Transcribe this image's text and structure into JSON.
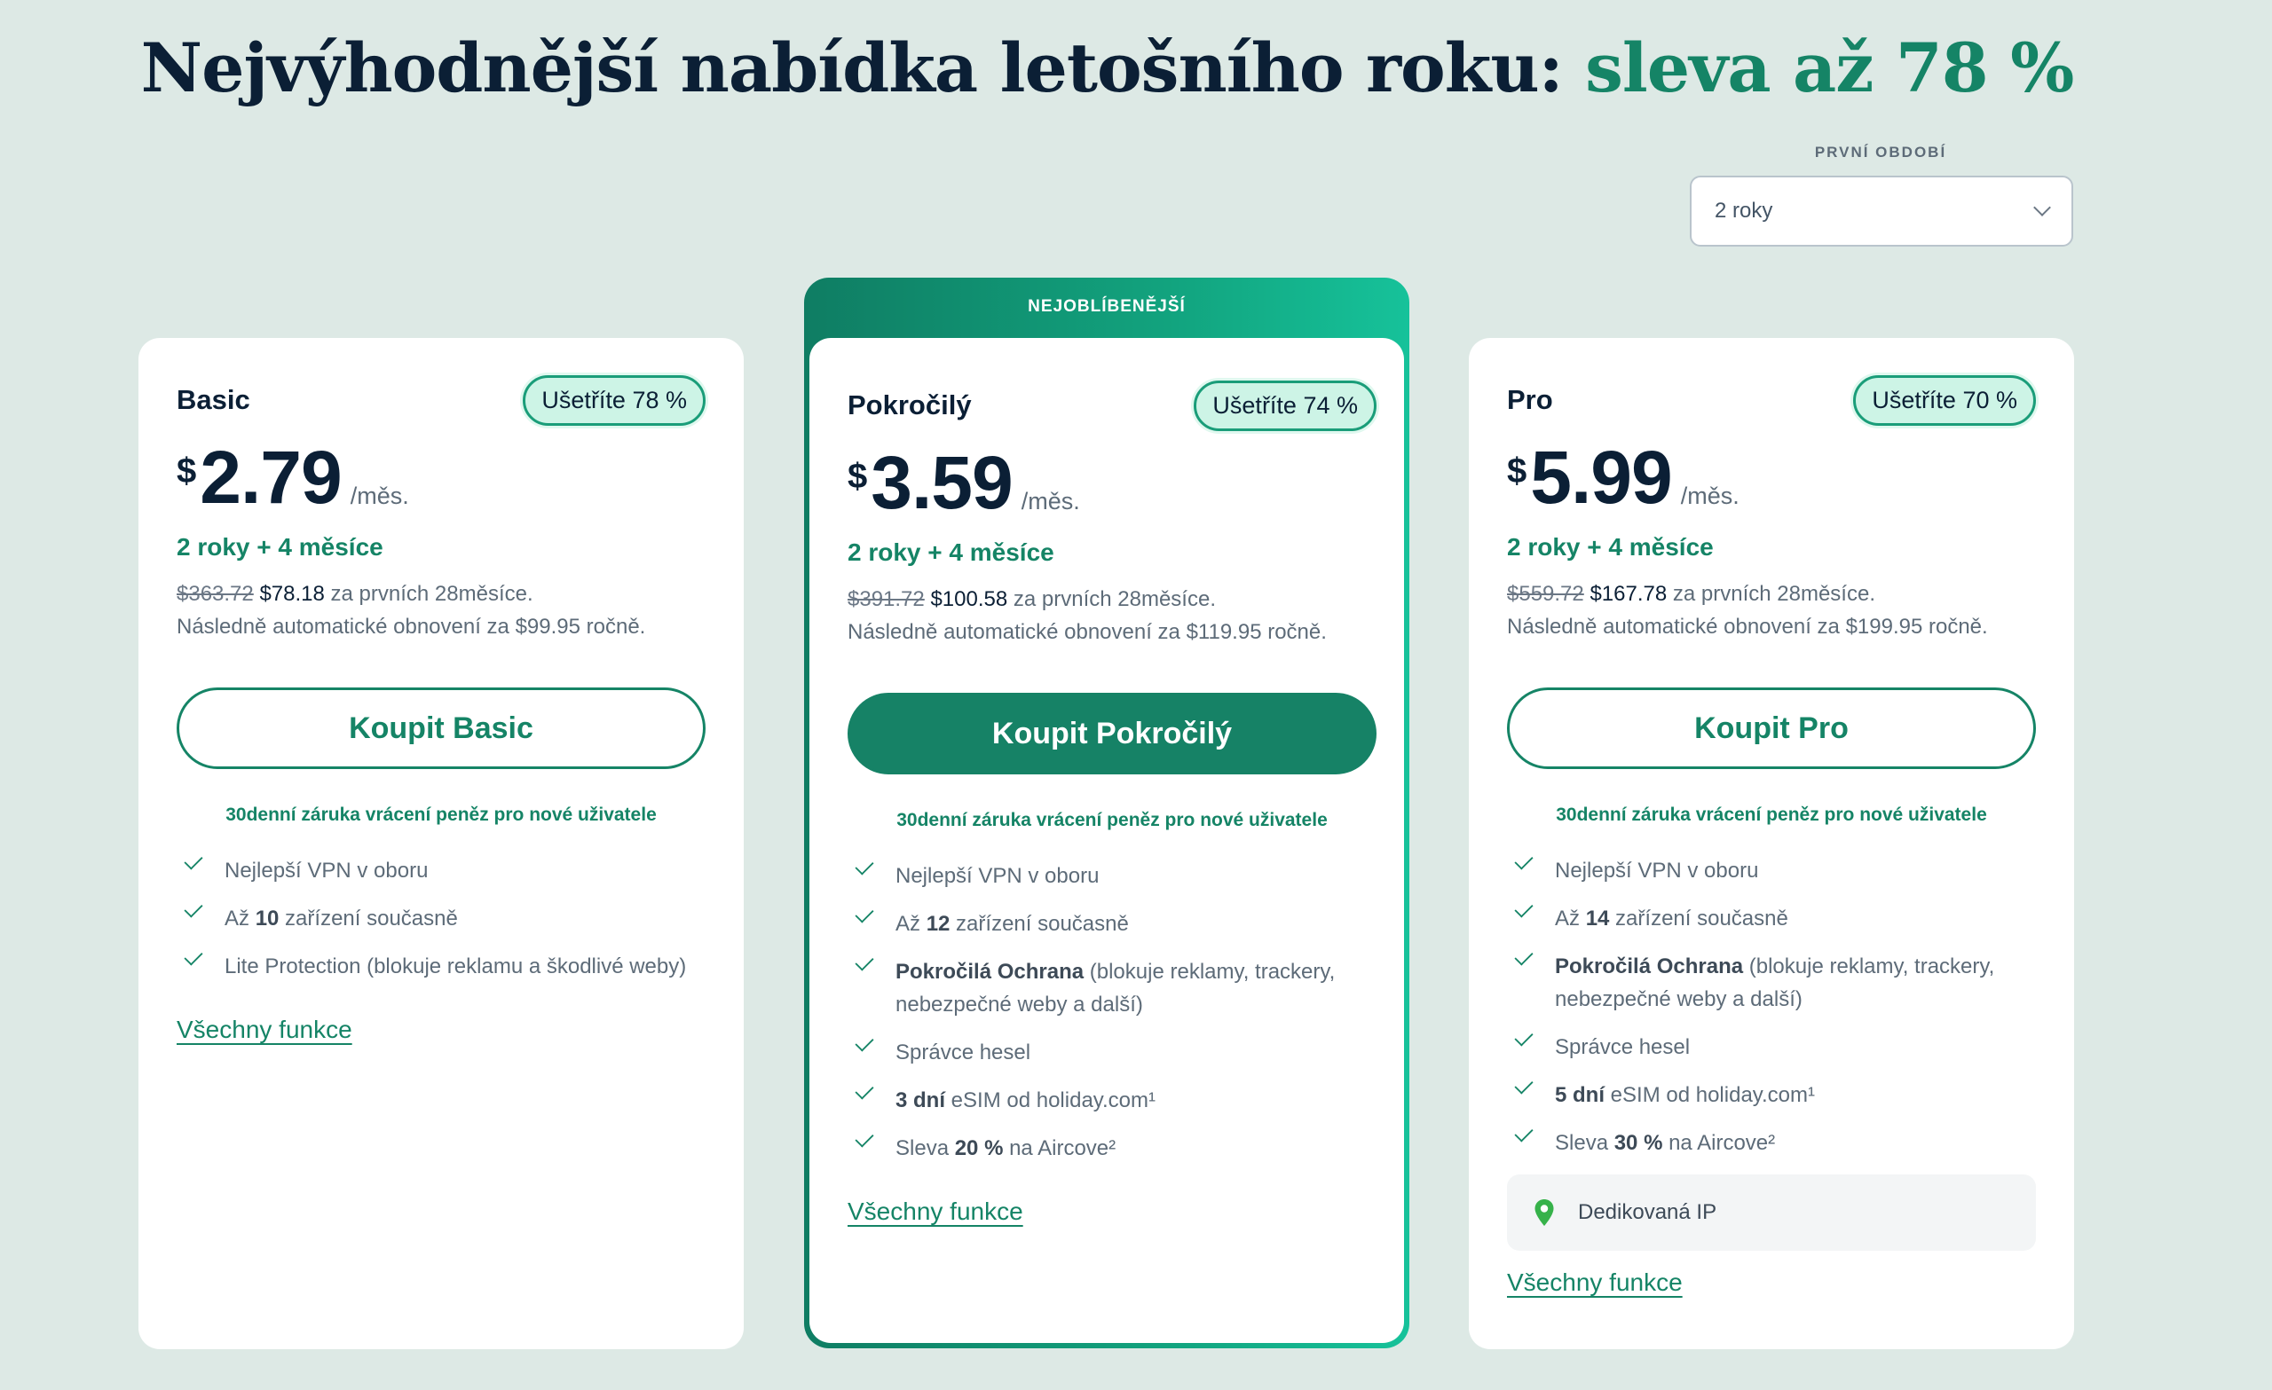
{
  "headline": {
    "main": "Nejvýhodnější nabídka letošního roku: ",
    "accent": "sleva až 78 %"
  },
  "period": {
    "label": "PRVNÍ OBDOBÍ",
    "value": "2 roky"
  },
  "featured_banner": "NEJOBLÍBENĚJŠÍ",
  "guarantee": "30denní záruka vrácení peněz pro nové uživatele",
  "all_features": "Všechny funkce",
  "colors": {
    "accent": "#158466",
    "background": "#dde9e5",
    "badge_bg": "#cdf4e6"
  },
  "plans": {
    "basic": {
      "name": "Basic",
      "save": "Ušetříte 78 %",
      "currency": "$",
      "amount": "2.79",
      "per": "/měs.",
      "term": "2 roky + 4 měsíce",
      "old_price": "$363.72",
      "new_price": "$78.18",
      "price_suffix": "za prvních 28měsíce.",
      "renewal": "Následně automatické obnovení za $99.95 ročně.",
      "button": "Koupit Basic",
      "features": [
        {
          "pre": "Nejlepší VPN v oboru",
          "bold": "",
          "post": ""
        },
        {
          "pre": "Až ",
          "bold": "10",
          "post": " zařízení současně"
        },
        {
          "pre": "Lite Protection (blokuje reklamu a škodlivé weby)",
          "bold": "",
          "post": ""
        }
      ]
    },
    "pokrocily": {
      "name": "Pokročilý",
      "save": "Ušetříte 74 %",
      "currency": "$",
      "amount": "3.59",
      "per": "/měs.",
      "term": "2 roky + 4 měsíce",
      "old_price": "$391.72",
      "new_price": "$100.58",
      "price_suffix": "za prvních 28měsíce.",
      "renewal": "Následně automatické obnovení za $119.95 ročně.",
      "button": "Koupit Pokročilý",
      "features": [
        {
          "pre": "Nejlepší VPN v oboru",
          "bold": "",
          "post": ""
        },
        {
          "pre": "Až ",
          "bold": "12",
          "post": " zařízení současně"
        },
        {
          "pre": "",
          "bold": "Pokročilá Ochrana",
          "post": " (blokuje reklamy, trackery, nebezpečné weby a další)"
        },
        {
          "pre": "Správce hesel",
          "bold": "",
          "post": ""
        },
        {
          "pre": "",
          "bold": "3 dní",
          "post": " eSIM od holiday.com¹"
        },
        {
          "pre": "Sleva ",
          "bold": "20 %",
          "post": " na Aircove²"
        }
      ]
    },
    "pro": {
      "name": "Pro",
      "save": "Ušetříte 70 %",
      "currency": "$",
      "amount": "5.99",
      "per": "/měs.",
      "term": "2 roky + 4 měsíce",
      "old_price": "$559.72",
      "new_price": "$167.78",
      "price_suffix": "za prvních 28měsíce.",
      "renewal": "Následně automatické obnovení za $199.95 ročně.",
      "button": "Koupit Pro",
      "features": [
        {
          "pre": "Nejlepší VPN v oboru",
          "bold": "",
          "post": ""
        },
        {
          "pre": "Až ",
          "bold": "14",
          "post": " zařízení současně"
        },
        {
          "pre": "",
          "bold": "Pokročilá Ochrana",
          "post": " (blokuje reklamy, trackery, nebezpečné weby a další)"
        },
        {
          "pre": "Správce hesel",
          "bold": "",
          "post": ""
        },
        {
          "pre": "",
          "bold": "5 dní",
          "post": " eSIM od holiday.com¹"
        },
        {
          "pre": "Sleva ",
          "bold": "30 %",
          "post": " na Aircove²"
        }
      ],
      "dedicated_ip": "Dedikovaná IP"
    }
  }
}
